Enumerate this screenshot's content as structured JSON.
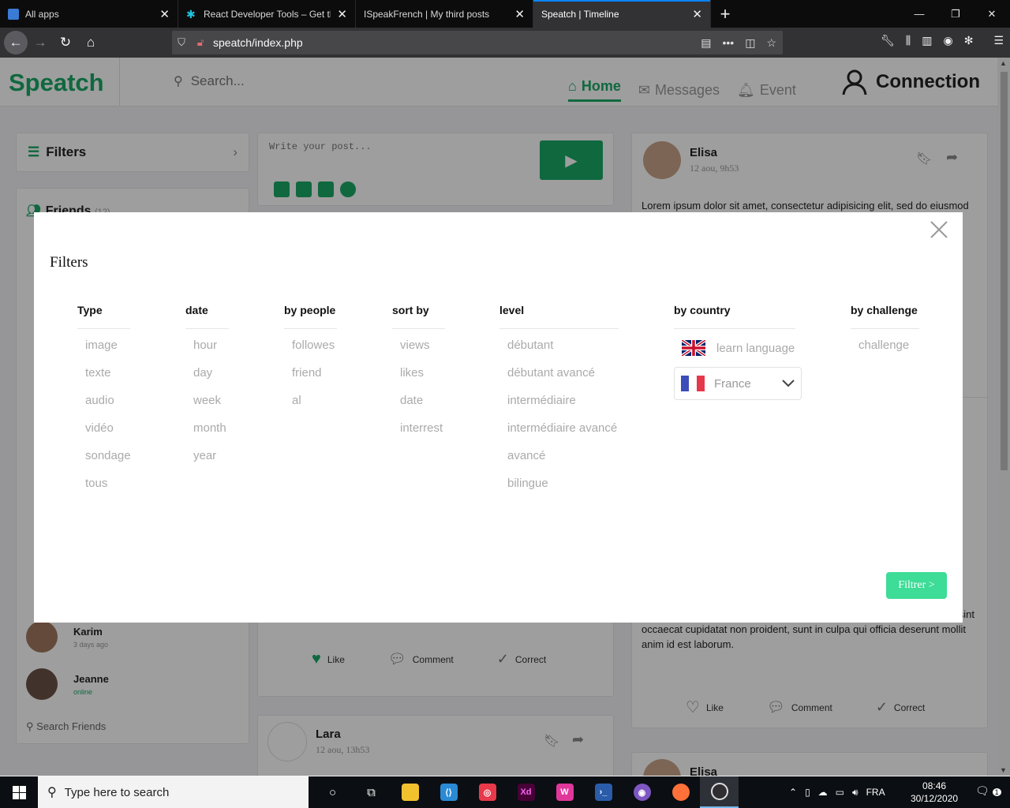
{
  "browser": {
    "tabs": [
      {
        "title": "All apps",
        "active": false
      },
      {
        "title": "React Developer Tools – Get thi",
        "active": false
      },
      {
        "title": "ISpeakFrench | My third posts",
        "active": false
      },
      {
        "title": "Speatch | Timeline",
        "active": true
      }
    ],
    "url": "speatch/index.php"
  },
  "app": {
    "logo": "Speatch",
    "search_placeholder": "Search...",
    "nav": [
      {
        "label": "Home",
        "icon": "home-icon",
        "active": true
      },
      {
        "label": "Messages",
        "icon": "messages-icon",
        "active": false
      },
      {
        "label": "Event",
        "icon": "bell-icon",
        "active": false
      }
    ],
    "connection_label": "Connection",
    "sidebar": {
      "filters_label": "Filters",
      "friends_label": "Friends",
      "friends_count": "(12)",
      "friends": [
        {
          "name": "Karim",
          "status": "3 days ago",
          "online": false
        },
        {
          "name": "Jeanne",
          "status": "online",
          "online": true
        }
      ],
      "search_friends": "Search Friends"
    },
    "composer": {
      "placeholder": "Write your post..."
    },
    "post_actions": {
      "like": "Like",
      "comment": "Comment",
      "correct": "Correct"
    },
    "posts": [
      {
        "author": "Elisa",
        "date": "12 aou, 9h53",
        "text_start": "Lorem ipsum dolor sit amet, consectetur adipisicing elit, sed do eiusmod",
        "text_end": "in voluptate velit esse cillum dolore eu fugiat nulla pariatur. Excepteur sint occaecat cupidatat non proident, sunt in culpa qui officia deserunt mollit anim id est laborum."
      },
      {
        "author": "Lara",
        "date": "12 aou, 13h53"
      },
      {
        "author": "Elisa"
      }
    ]
  },
  "modal": {
    "title": "Filters",
    "columns": [
      {
        "heading": "Type",
        "options": [
          "image",
          "texte",
          "audio",
          "vidéo",
          "sondage",
          "tous"
        ]
      },
      {
        "heading": "date",
        "options": [
          "hour",
          "day",
          "week",
          "month",
          "year"
        ]
      },
      {
        "heading": "by people",
        "options": [
          "followes",
          "friend",
          "al"
        ]
      },
      {
        "heading": "sort by",
        "options": [
          "views",
          "likes",
          "date",
          "interrest"
        ]
      },
      {
        "heading": "level",
        "options": [
          "débutant",
          "débutant avancé",
          "intermédiaire",
          "intermédiaire avancé",
          "avancé",
          "bilingue"
        ]
      }
    ],
    "country": {
      "heading": "by country",
      "learn_language": "learn language",
      "selected_country": "France"
    },
    "challenge": {
      "heading": "by challenge",
      "options": [
        "challenge"
      ]
    },
    "submit_label": "Filtrer >",
    "colors": {
      "submit": "#3ddc97",
      "brand": "#1aa867"
    }
  },
  "taskbar": {
    "search_placeholder": "Type here to search",
    "language": "FRA",
    "time": "08:46",
    "date": "30/12/2020",
    "notification_count": "1"
  }
}
